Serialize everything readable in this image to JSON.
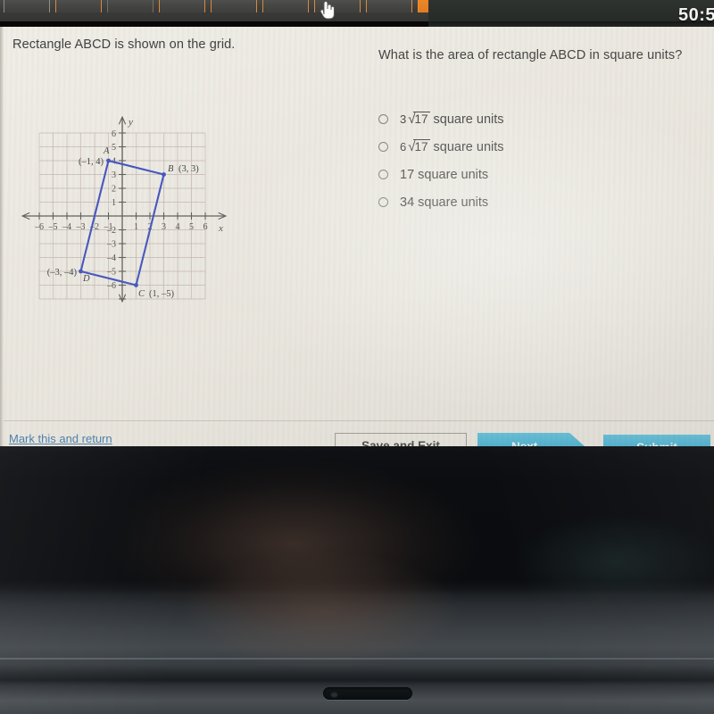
{
  "browser": {
    "tabs": [
      "tab",
      "tab",
      "tab",
      "tab",
      "tab",
      "tab",
      "tab",
      "tab",
      "tab"
    ],
    "timer": "50:5"
  },
  "question": {
    "prompt": "Rectangle ABCD is shown on the grid.",
    "text": "What is the area of rectangle ABCD in square units?"
  },
  "choices": [
    {
      "coefficient": "3",
      "radicand": "17",
      "suffix": " square units",
      "plain": null,
      "selected": false
    },
    {
      "coefficient": "6",
      "radicand": "17",
      "suffix": " square units",
      "plain": null,
      "selected": false
    },
    {
      "coefficient": null,
      "radicand": null,
      "suffix": " square units",
      "plain": "17",
      "selected": false
    },
    {
      "coefficient": null,
      "radicand": null,
      "suffix": " square units",
      "plain": "34",
      "selected": false
    }
  ],
  "toolbar": {
    "mark_return": "Mark this and return",
    "save_exit": "Save and Exit",
    "next": "Next",
    "submit": "Submit",
    "accent_color": "#30ADD6"
  },
  "chart_data": {
    "type": "scatter",
    "title": "",
    "xlabel": "x",
    "ylabel": "y",
    "xlim": [
      -7,
      7
    ],
    "ylim": [
      -7,
      7
    ],
    "grid": true,
    "x_ticks": [
      -6,
      -5,
      -4,
      -3,
      -2,
      -1,
      1,
      2,
      3,
      4,
      5,
      6
    ],
    "y_ticks": [
      -6,
      -5,
      -4,
      -3,
      -2,
      -1,
      1,
      2,
      3,
      4,
      5,
      6
    ],
    "grid_extent": {
      "x_min": -6,
      "x_max": 6,
      "y_min": -6,
      "y_max": 6
    },
    "shape": "rectangle",
    "shape_color": "#2b3fbe",
    "vertices": [
      {
        "name": "A",
        "x": -1,
        "y": 4,
        "label": "(–1, 4)",
        "label_pos": "left",
        "name_pos": "above-left"
      },
      {
        "name": "B",
        "x": 3,
        "y": 3,
        "label": "(3, 3)",
        "label_pos": "right",
        "name_pos": "above-left"
      },
      {
        "name": "C",
        "x": 1,
        "y": -5,
        "label": "(1, –5)",
        "label_pos": "right",
        "name_pos": "below-right"
      },
      {
        "name": "D",
        "x": -3,
        "y": -4,
        "label": "(–3, –4)",
        "label_pos": "left",
        "name_pos": "below-right"
      }
    ]
  }
}
